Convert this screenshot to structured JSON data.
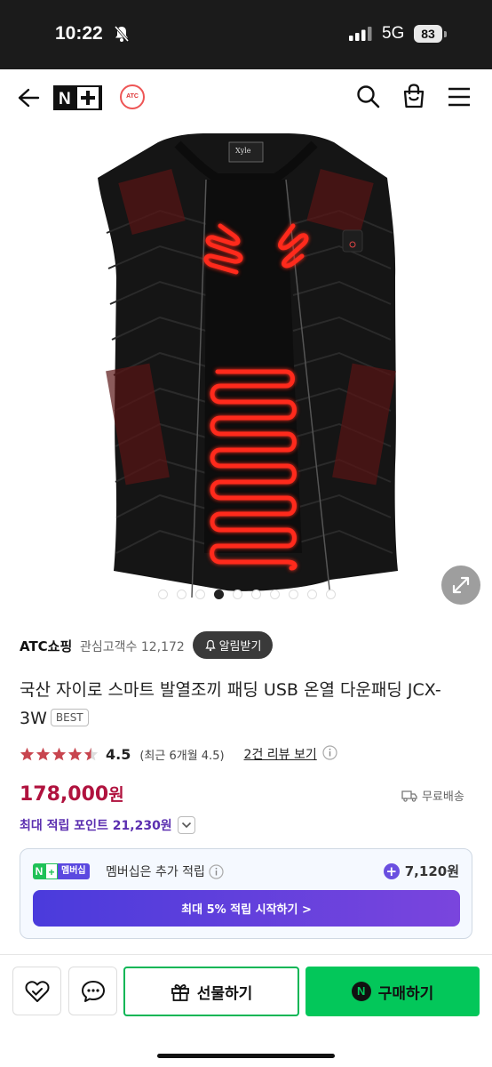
{
  "status_bar": {
    "time": "10:22",
    "network": "5G",
    "battery": "83"
  },
  "header": {
    "logo_text": "N+",
    "brand_logo_text": "ATC"
  },
  "product_image": {
    "vest_label": "Xyle",
    "slide_count": 10,
    "active_slide": 4
  },
  "shop": {
    "name": "ATC쇼핑",
    "interest_label": "관심고객수 12,172",
    "alarm_label": "알림받기"
  },
  "product": {
    "title": "국산 자이로 스마트 발열조끼 패딩 USB 온열 다운패딩 JCX-3W",
    "badge": "BEST"
  },
  "rating": {
    "stars": 4.5,
    "value": "4.5",
    "recent": "(최근 6개월 4.5)",
    "review_link": "2건 리뷰 보기"
  },
  "price": {
    "amount": "178,000",
    "unit": "원",
    "shipping": "무료배송",
    "points_label": "최대 적립 포인트 21,230원"
  },
  "membership": {
    "badge_n": "N",
    "badge_plus": "+",
    "badge_label": "멤버십",
    "text": "멤버십은 추가 적립",
    "extra_points": "7,120원",
    "cta": "최대 5% 적립 시작하기 >"
  },
  "bottom_bar": {
    "gift_label": "선물하기",
    "buy_label": "구매하기",
    "buy_icon": "N"
  },
  "colors": {
    "price": "#b0123e",
    "points": "#5b2fb0",
    "buy": "#03c75a",
    "member_cta": "#5b3fdc"
  }
}
